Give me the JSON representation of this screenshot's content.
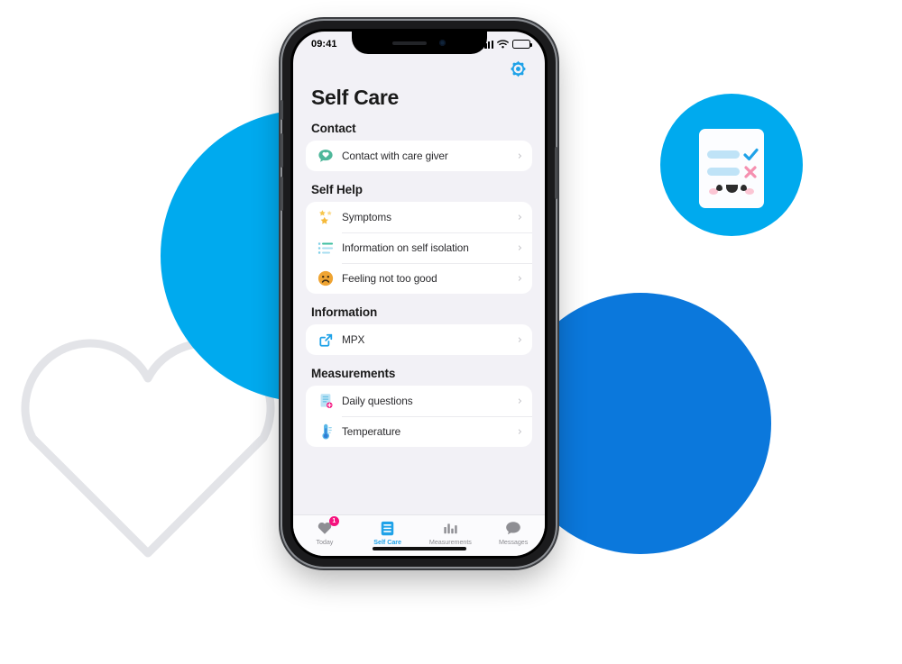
{
  "decor": {
    "circle_light_color": "#00AAEE",
    "circle_dark_color": "#0B78DC",
    "badge_circle_color": "#00AAEE",
    "heart_outline_color": "#E3E4E8",
    "checklist": {
      "check_color": "#1FA2E8",
      "cross_color": "#F590B0",
      "bar_color": "#BFE3F7",
      "blush_color": "#FBC6D4"
    }
  },
  "phone": {
    "status_bar": {
      "time": "09:41",
      "signal_icon": "signal-bars-icon",
      "wifi_icon": "wifi-icon",
      "battery_icon": "battery-icon"
    },
    "header": {
      "settings_icon": "gear-icon",
      "title": "Self Care",
      "accent_color": "#1FA2E8"
    },
    "sections": [
      {
        "title": "Contact",
        "items": [
          {
            "label": "Contact with care giver",
            "icon": "chat-heart-icon",
            "chevron": "›"
          }
        ]
      },
      {
        "title": "Self Help",
        "items": [
          {
            "label": "Symptoms",
            "icon": "stars-icon",
            "chevron": "›"
          },
          {
            "label": "Information on self isolation",
            "icon": "list-icon",
            "chevron": "›"
          },
          {
            "label": "Feeling not too good",
            "icon": "sad-face-icon",
            "chevron": "›"
          }
        ]
      },
      {
        "title": "Information",
        "items": [
          {
            "label": "MPX",
            "icon": "external-link-icon",
            "chevron": "›"
          }
        ]
      },
      {
        "title": "Measurements",
        "items": [
          {
            "label": "Daily questions",
            "icon": "document-badge-icon",
            "chevron": "›"
          },
          {
            "label": "Temperature",
            "icon": "thermometer-icon",
            "chevron": "›"
          }
        ]
      }
    ],
    "tab_bar": {
      "active_color": "#1FA2E8",
      "inactive_color": "#8E8E93",
      "badge_color": "#F5127E",
      "tabs": [
        {
          "label": "Today",
          "icon": "heart-icon",
          "active": false,
          "badge": "1"
        },
        {
          "label": "Self Care",
          "icon": "document-icon",
          "active": true,
          "badge": ""
        },
        {
          "label": "Measurements",
          "icon": "bar-chart-icon",
          "active": false,
          "badge": ""
        },
        {
          "label": "Messages",
          "icon": "speech-bubble-icon",
          "active": false,
          "badge": ""
        }
      ]
    }
  }
}
